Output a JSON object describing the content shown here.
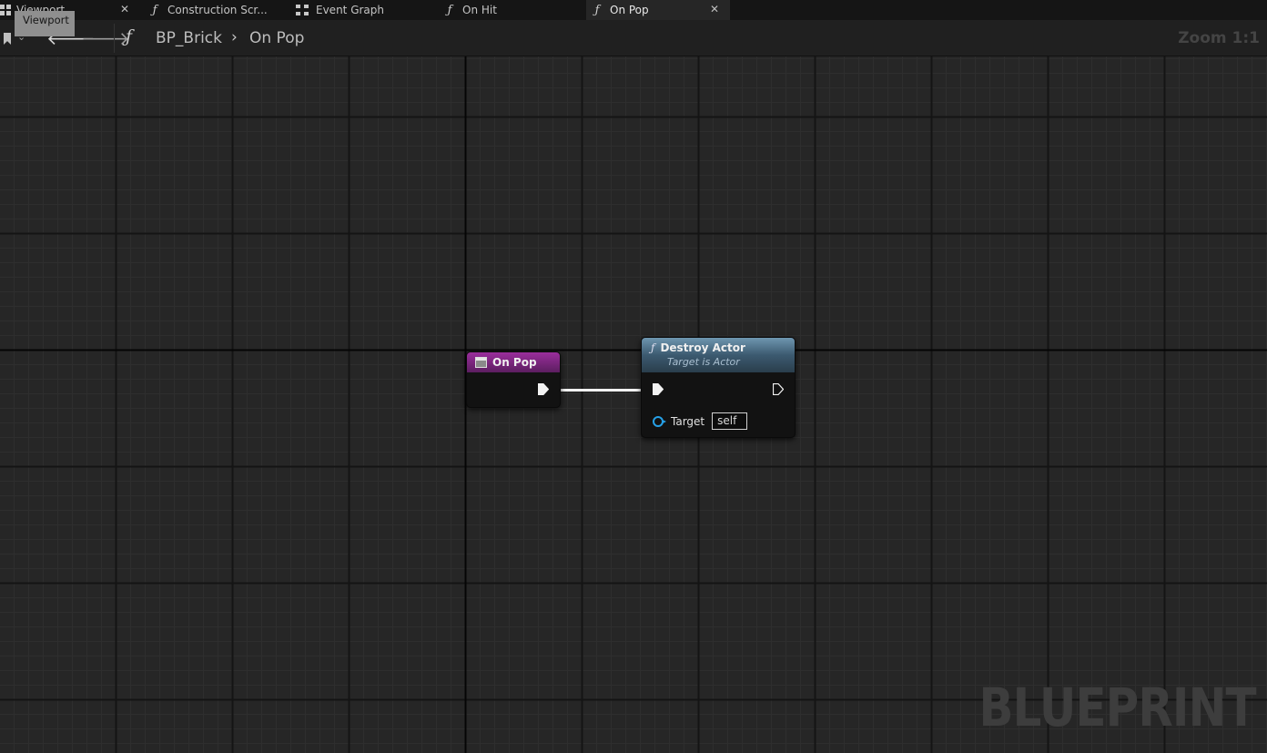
{
  "tabs": [
    {
      "label": "Viewport",
      "icon": "viewport-icon",
      "closable": true
    },
    {
      "label": "Construction Scr...",
      "icon": "function-icon",
      "closable": false
    },
    {
      "label": "Event Graph",
      "icon": "event-graph-icon",
      "closable": false
    },
    {
      "label": "On Hit",
      "icon": "function-icon",
      "closable": false
    },
    {
      "label": "On Pop",
      "icon": "function-icon",
      "closable": true,
      "active": true
    }
  ],
  "tooltip": "Viewport",
  "toolbar": {
    "breadcrumb": [
      "BP_Brick",
      "On Pop"
    ],
    "zoom": "Zoom 1:1"
  },
  "graph": {
    "watermark": "BLUEPRINT",
    "nodes": {
      "entry": {
        "title": "On Pop",
        "color": "#9a2e9c"
      },
      "call": {
        "title": "Destroy Actor",
        "subtitle": "Target is Actor",
        "color": "#4f7591",
        "pin_label": "Target",
        "pin_value": "self"
      }
    }
  },
  "colors": {
    "background": "#262626",
    "object_pin": "#26a0e6",
    "tab_active": "#262626"
  }
}
